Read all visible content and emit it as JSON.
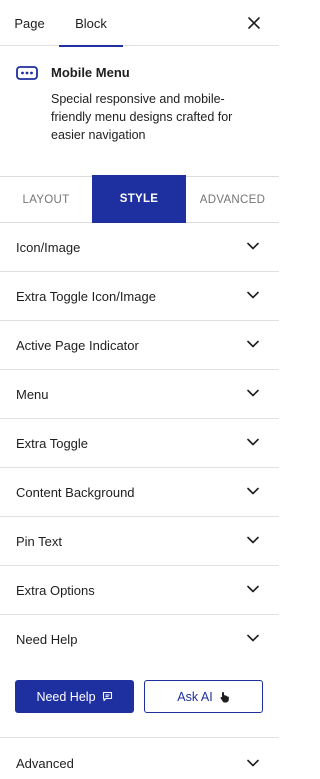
{
  "top_tabs": {
    "page": "Page",
    "block": "Block"
  },
  "block_info": {
    "icon": "menu-dots-icon",
    "title": "Mobile Menu",
    "description": "Special responsive and mobile-friendly menu designs crafted for easier navigation"
  },
  "style_tabs": {
    "layout": "LAYOUT",
    "style": "STYLE",
    "advanced": "ADVANCED"
  },
  "panels": [
    "Icon/Image",
    "Extra Toggle Icon/Image",
    "Active Page Indicator",
    "Menu",
    "Extra Toggle",
    "Content Background",
    "Pin Text",
    "Extra Options",
    "Need Help"
  ],
  "help_buttons": {
    "need_help": "Need Help",
    "ask_ai": "Ask AI"
  },
  "advanced_panel": "Advanced",
  "colors": {
    "accent": "#1e2fa0",
    "border": "#e0e0e0",
    "text": "#1e1e1e",
    "muted": "#757575"
  }
}
